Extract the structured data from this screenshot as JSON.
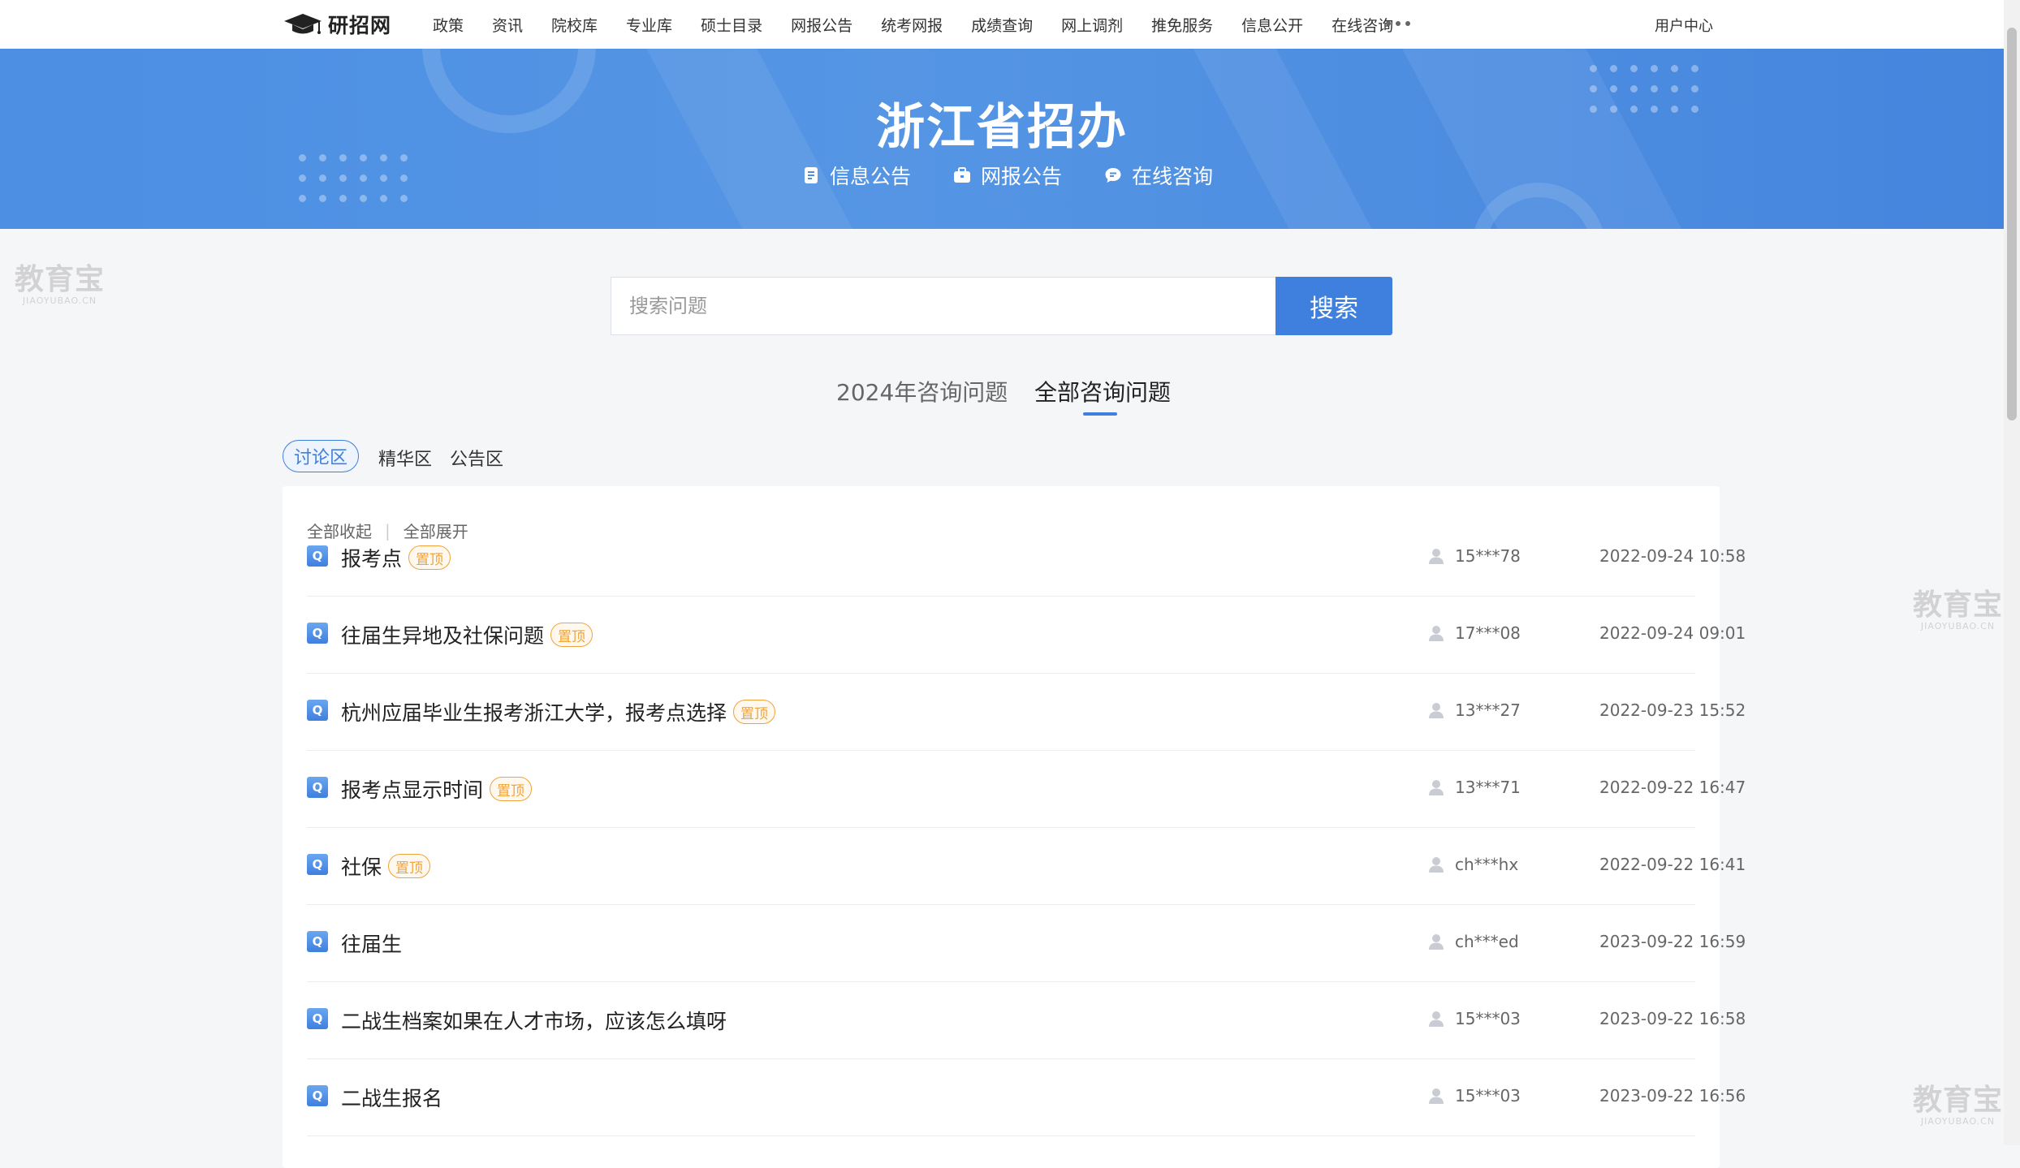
{
  "site": {
    "logo_text": "研招网"
  },
  "nav": {
    "items": [
      {
        "label": "政策"
      },
      {
        "label": "资讯"
      },
      {
        "label": "院校库"
      },
      {
        "label": "专业库"
      },
      {
        "label": "硕士目录"
      },
      {
        "label": "网报公告"
      },
      {
        "label": "统考网报"
      },
      {
        "label": "成绩查询"
      },
      {
        "label": "网上调剂"
      },
      {
        "label": "推免服务"
      },
      {
        "label": "信息公开"
      },
      {
        "label": "在线咨询"
      }
    ],
    "user_center": "用户中心"
  },
  "banner": {
    "title": "浙江省招办",
    "links": [
      {
        "label": "信息公告",
        "icon": "document-icon"
      },
      {
        "label": "网报公告",
        "icon": "briefcase-icon"
      },
      {
        "label": "在线咨询",
        "icon": "chat-bubble-icon"
      }
    ]
  },
  "search": {
    "placeholder": "搜索问题",
    "button": "搜索"
  },
  "tabs": [
    {
      "label": "2024年咨询问题"
    },
    {
      "label": "全部咨询问题"
    }
  ],
  "subtabs": [
    {
      "label": "讨论区"
    },
    {
      "label": "精华区"
    },
    {
      "label": "公告区"
    }
  ],
  "actions": {
    "collapse_all": "全部收起",
    "separator": "|",
    "expand_all": "全部展开"
  },
  "questions": [
    {
      "badge": "Q",
      "title": "报考点",
      "pin": "置顶",
      "user": "15***78",
      "date": "2022-09-24 10:58"
    },
    {
      "badge": "Q",
      "title": "往届生异地及社保问题",
      "pin": "置顶",
      "user": "17***08",
      "date": "2022-09-24 09:01"
    },
    {
      "badge": "Q",
      "title": "杭州应届毕业生报考浙江大学，报考点选择",
      "pin": "置顶",
      "user": "13***27",
      "date": "2022-09-23 15:52"
    },
    {
      "badge": "Q",
      "title": "报考点显示时间",
      "pin": "置顶",
      "user": "13***71",
      "date": "2022-09-22 16:47"
    },
    {
      "badge": "Q",
      "title": "社保",
      "pin": "置顶",
      "user": "ch***hx",
      "date": "2022-09-22 16:41"
    },
    {
      "badge": "Q",
      "title": "往届生",
      "pin": "",
      "user": "ch***ed",
      "date": "2023-09-22 16:59"
    },
    {
      "badge": "Q",
      "title": "二战生档案如果在人才市场，应该怎么填呀",
      "pin": "",
      "user": "15***03",
      "date": "2023-09-22 16:58"
    },
    {
      "badge": "Q",
      "title": "二战生报名",
      "pin": "",
      "user": "15***03",
      "date": "2023-09-22 16:56"
    }
  ],
  "watermark": {
    "text": "教育宝",
    "sub": "JIAOYUBAO.CN"
  },
  "colors": {
    "primary": "#3f7fde",
    "banner": "#4c8fe3",
    "pin": "#f0a33a"
  }
}
